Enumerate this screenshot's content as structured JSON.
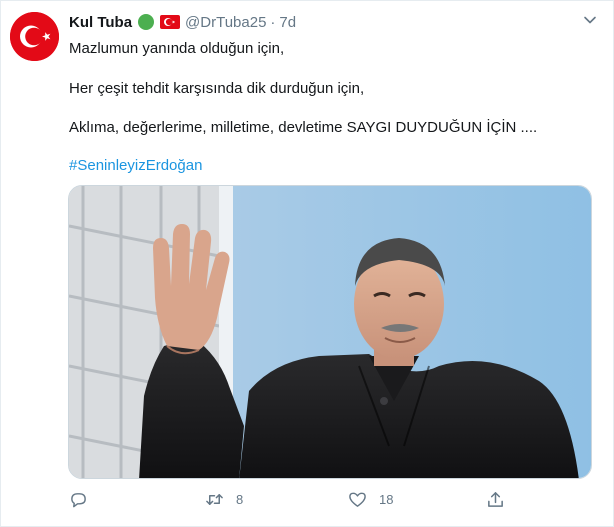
{
  "tweet": {
    "author_name": "Kul Tuba",
    "author_handle": "@DrTuba25",
    "separator": "·",
    "time": "7d",
    "lines": [
      "Mazlumun yanında olduğun için,",
      "Her çeşit tehdit karşısında dik durduğun için,",
      "Aklıma, değerlerime, milletime, devletime SAYGI DUYDUĞUN İÇİN ...."
    ],
    "hashtag": "#SeninleyizErdoğan"
  },
  "actions": {
    "reply": {
      "icon": "reply-icon",
      "count": ""
    },
    "retweet": {
      "icon": "retweet-icon",
      "count": "8"
    },
    "like": {
      "icon": "heart-icon",
      "count": "18"
    },
    "share": {
      "icon": "share-icon",
      "count": ""
    }
  },
  "colors": {
    "link": "#1b95e0",
    "muted": "#657786",
    "flag_red": "#e30a17",
    "verified_green": "#4caf50"
  }
}
